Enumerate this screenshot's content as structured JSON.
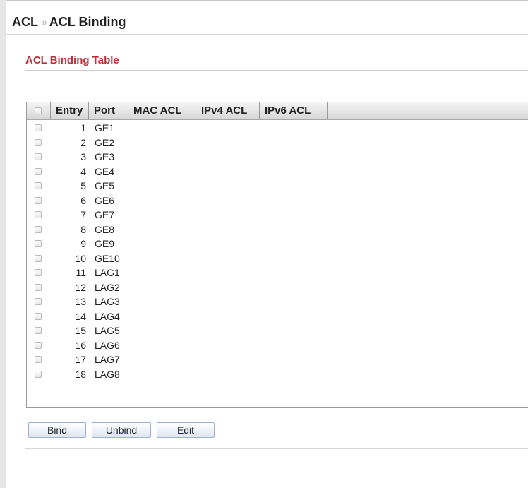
{
  "breadcrumb": {
    "parent": "ACL",
    "separator": "»",
    "current": "ACL Binding"
  },
  "section": {
    "title": "ACL Binding Table"
  },
  "table": {
    "columns": {
      "entry": "Entry",
      "port": "Port",
      "mac_acl": "MAC ACL",
      "ipv4_acl": "IPv4 ACL",
      "ipv6_acl": "IPv6 ACL"
    },
    "rows": [
      {
        "entry": "1",
        "port": "GE1"
      },
      {
        "entry": "2",
        "port": "GE2"
      },
      {
        "entry": "3",
        "port": "GE3"
      },
      {
        "entry": "4",
        "port": "GE4"
      },
      {
        "entry": "5",
        "port": "GE5"
      },
      {
        "entry": "6",
        "port": "GE6"
      },
      {
        "entry": "7",
        "port": "GE7"
      },
      {
        "entry": "8",
        "port": "GE8"
      },
      {
        "entry": "9",
        "port": "GE9"
      },
      {
        "entry": "10",
        "port": "GE10"
      },
      {
        "entry": "11",
        "port": "LAG1"
      },
      {
        "entry": "12",
        "port": "LAG2"
      },
      {
        "entry": "13",
        "port": "LAG3"
      },
      {
        "entry": "14",
        "port": "LAG4"
      },
      {
        "entry": "15",
        "port": "LAG5"
      },
      {
        "entry": "16",
        "port": "LAG6"
      },
      {
        "entry": "17",
        "port": "LAG7"
      },
      {
        "entry": "18",
        "port": "LAG8"
      }
    ]
  },
  "buttons": {
    "bind": "Bind",
    "unbind": "Unbind",
    "edit": "Edit"
  },
  "colors": {
    "section_title": "#b6343a",
    "button_border": "#9fb1cc"
  }
}
